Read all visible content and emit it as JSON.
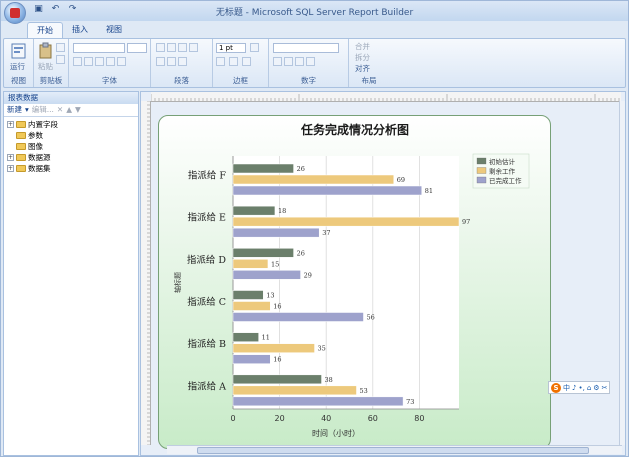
{
  "window": {
    "title": "无标题 - Microsoft SQL Server Report Builder"
  },
  "ribbon": {
    "tabs": [
      "开始",
      "插入",
      "视图"
    ],
    "active_tab": "开始",
    "groups": {
      "view": "视图",
      "clipboard": "剪贴板",
      "font": "字体",
      "paragraph": "段落",
      "border": "边框",
      "number": "数字",
      "layout": "布局"
    },
    "run_label": "运行",
    "paste_label": "粘贴",
    "border_width": "1 pt",
    "layout_items": [
      "合并",
      "拆分",
      "对齐"
    ]
  },
  "report_data_pane": {
    "title": "报表数据",
    "toolbar_new": "新建",
    "toolbar_edit": "编辑...",
    "tree": [
      "内置字段",
      "参数",
      "图像",
      "数据源",
      "数据集"
    ]
  },
  "ime": {
    "logo": "S",
    "items": [
      "中",
      "♪",
      "•,",
      "⌂",
      "⚙",
      "✂"
    ]
  },
  "colors": {
    "series1": "#6b7f6b",
    "series2": "#edc97c",
    "series3": "#9ea2cc",
    "panel_border": "#77a077",
    "accent": "#15428b"
  },
  "chart_data": {
    "type": "bar",
    "orientation": "horizontal",
    "title": "任务完成情况分析图",
    "xlabel": "时间（小时）",
    "ylabel": "轴标题",
    "categories": [
      "指派给 F",
      "指派给 E",
      "指派给 D",
      "指派给 C",
      "指派给 B",
      "指派给 A"
    ],
    "series": [
      {
        "name": "初始估计",
        "color": "#6b7f6b",
        "values": [
          26,
          18,
          26,
          13,
          11,
          38
        ]
      },
      {
        "name": "剩余工作",
        "color": "#edc97c",
        "values": [
          69,
          97,
          15,
          16,
          35,
          53
        ]
      },
      {
        "name": "已完成工作",
        "color": "#9ea2cc",
        "values": [
          81,
          37,
          29,
          56,
          16,
          73
        ]
      }
    ],
    "xlim": [
      0,
      97
    ],
    "x_ticks": [
      0,
      20,
      40,
      60,
      80
    ],
    "grid": true,
    "legend_position": "top-right"
  }
}
